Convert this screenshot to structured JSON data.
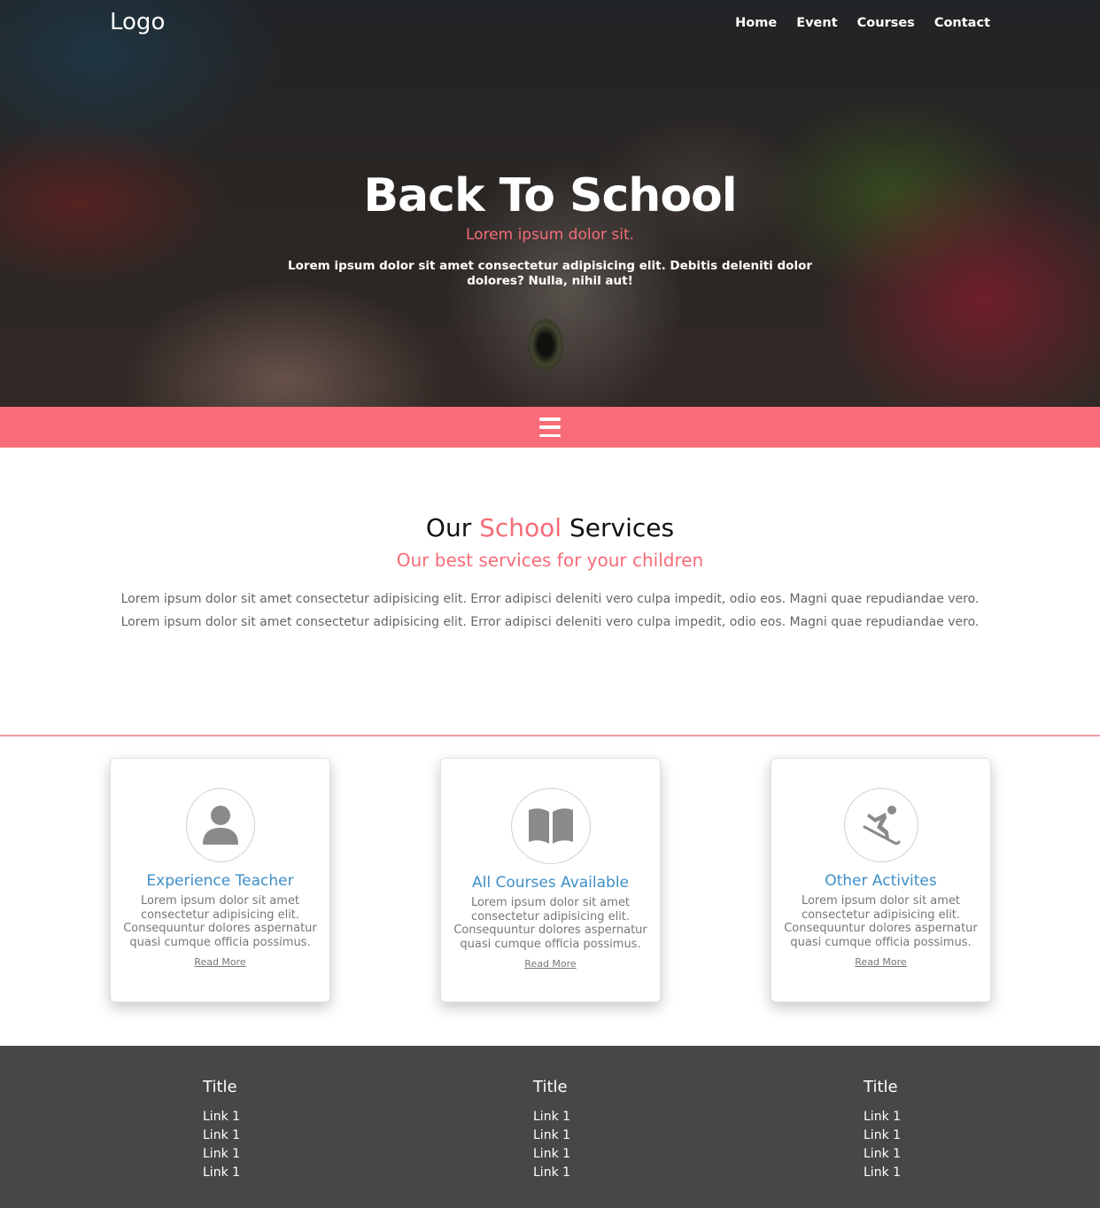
{
  "nav": {
    "logo": "Logo",
    "items": [
      "Home",
      "Event",
      "Courses",
      "Contact"
    ]
  },
  "hero": {
    "title": "Back To School",
    "subtitle": "Lorem ipsum dolor sit.",
    "description": "Lorem ipsum dolor sit amet consectetur adipisicing elit. Debitis deleniti dolor dolores? Nulla, nihil aut!"
  },
  "toggle": {
    "icon": "hamburger-menu-icon"
  },
  "services": {
    "title_before": "Our ",
    "title_accent": "School",
    "title_after": " Services",
    "subtitle": "Our best services for your children",
    "paragraph_1": "Lorem ipsum dolor sit amet consectetur adipisicing elit. Error adipisci deleniti vero culpa impedit, odio eos. Magni quae repudiandae vero.",
    "paragraph_2": "Lorem ipsum dolor sit amet consectetur adipisicing elit. Error adipisci deleniti vero culpa impedit, odio eos. Magni quae repudiandae vero."
  },
  "cards": [
    {
      "icon": "user-icon",
      "title": "Experience Teacher",
      "text": "Lorem ipsum dolor sit amet consectetur adipisicing elit. Consequuntur dolores aspernatur quasi cumque officia possimus.",
      "link": "Read More"
    },
    {
      "icon": "book-icon",
      "title": "All Courses Available",
      "text": "Lorem ipsum dolor sit amet consectetur adipisicing elit. Consequuntur dolores aspernatur quasi cumque officia possimus.",
      "link": "Read More"
    },
    {
      "icon": "skiing-icon",
      "title": "Other Activites",
      "text": "Lorem ipsum dolor sit amet consectetur adipisicing elit. Consequuntur dolores aspernatur quasi cumque officia possimus.",
      "link": "Read More"
    }
  ],
  "footer": {
    "columns": [
      {
        "title": "Title",
        "links": [
          "Link 1",
          "Link 1",
          "Link 1",
          "Link 1"
        ]
      },
      {
        "title": "Title",
        "links": [
          "Link 1",
          "Link 1",
          "Link 1",
          "Link 1"
        ]
      },
      {
        "title": "Title",
        "links": [
          "Link 1",
          "Link 1",
          "Link 1",
          "Link 1"
        ]
      }
    ]
  },
  "colors": {
    "accent": "#f76c78",
    "card_title": "#3d8fc8",
    "footer_bg": "#474747"
  }
}
